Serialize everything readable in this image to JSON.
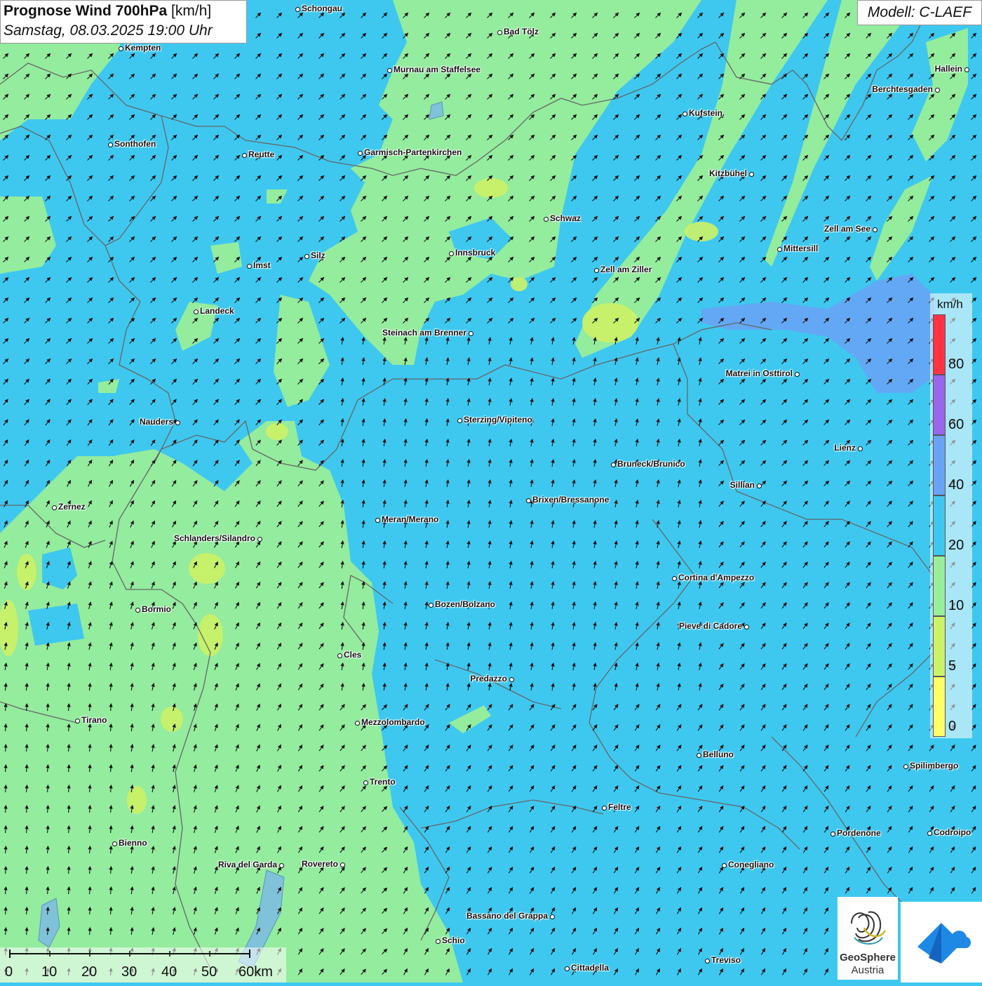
{
  "header": {
    "title_bold": "Prognose Wind 700hPa",
    "title_unit": "[km/h]",
    "datetime": "Samstag, 08.03.2025 19:00 Uhr",
    "model": "Modell: C-LAEF"
  },
  "colors": {
    "wind_0_5": "#ffff66",
    "wind_5_10": "#ccf266",
    "wind_10_20": "#99ee99",
    "wind_20_40": "#3ec8f0",
    "wind_40_60": "#6aa2f5",
    "wind_60_80": "#9966ee",
    "wind_80_plus": "#ff3344",
    "borders": "#666666"
  },
  "legend": {
    "unit": "km/h",
    "ticks": [
      "80",
      "60",
      "40",
      "20",
      "10",
      "5",
      "0"
    ]
  },
  "scale_bar": {
    "ticks": [
      "0",
      "10",
      "20",
      "30",
      "40",
      "50",
      "60km"
    ]
  },
  "logos": {
    "geosphere_line1": "GeoSphere",
    "geosphere_line2": "Austria",
    "geosphere_icon": "geosphere-swirl-icon",
    "second_icon": "weather-app-icon"
  },
  "cities": [
    {
      "name": "Schongau"
    },
    {
      "name": "Bad Tölz"
    },
    {
      "name": "Kempten"
    },
    {
      "name": "Murnau am Staffelsee"
    },
    {
      "name": "Hallein"
    },
    {
      "name": "Berchtesgaden"
    },
    {
      "name": "Kufstein"
    },
    {
      "name": "Sonthofen"
    },
    {
      "name": "Reutte"
    },
    {
      "name": "Garmisch-Partenkirchen"
    },
    {
      "name": "Kitzbühel"
    },
    {
      "name": "Schwaz"
    },
    {
      "name": "Zell am See"
    },
    {
      "name": "Mittersill"
    },
    {
      "name": "Innsbruck"
    },
    {
      "name": "Imst"
    },
    {
      "name": "Silz"
    },
    {
      "name": "Zell am Ziller"
    },
    {
      "name": "Landeck"
    },
    {
      "name": "Steinach am Brenner"
    },
    {
      "name": "Matrei in Osttirol"
    },
    {
      "name": "Nauders"
    },
    {
      "name": "Sterzing/Vipiteno"
    },
    {
      "name": "Lienz"
    },
    {
      "name": "Bruneck/Brunico"
    },
    {
      "name": "Sillian"
    },
    {
      "name": "Brixen/Bressanone"
    },
    {
      "name": "Zernez"
    },
    {
      "name": "Meran/Merano"
    },
    {
      "name": "Schlanders/Silandro"
    },
    {
      "name": "Cortina d'Ampezzo"
    },
    {
      "name": "Bozen/Bolzano"
    },
    {
      "name": "Bormio"
    },
    {
      "name": "Pieve di Cadore"
    },
    {
      "name": "Cles"
    },
    {
      "name": "Predazzo"
    },
    {
      "name": "Tirano"
    },
    {
      "name": "Mezzolombardo"
    },
    {
      "name": "Belluno"
    },
    {
      "name": "Spilimbergo"
    },
    {
      "name": "Trento"
    },
    {
      "name": "Feltre"
    },
    {
      "name": "Pordenone"
    },
    {
      "name": "Codroipo"
    },
    {
      "name": "Bienno"
    },
    {
      "name": "Riva del Garda"
    },
    {
      "name": "Rovereto"
    },
    {
      "name": "Conegliano"
    },
    {
      "name": "Bassano del Grappa"
    },
    {
      "name": "Schio"
    },
    {
      "name": "Treviso"
    },
    {
      "name": "Cittadella"
    }
  ]
}
